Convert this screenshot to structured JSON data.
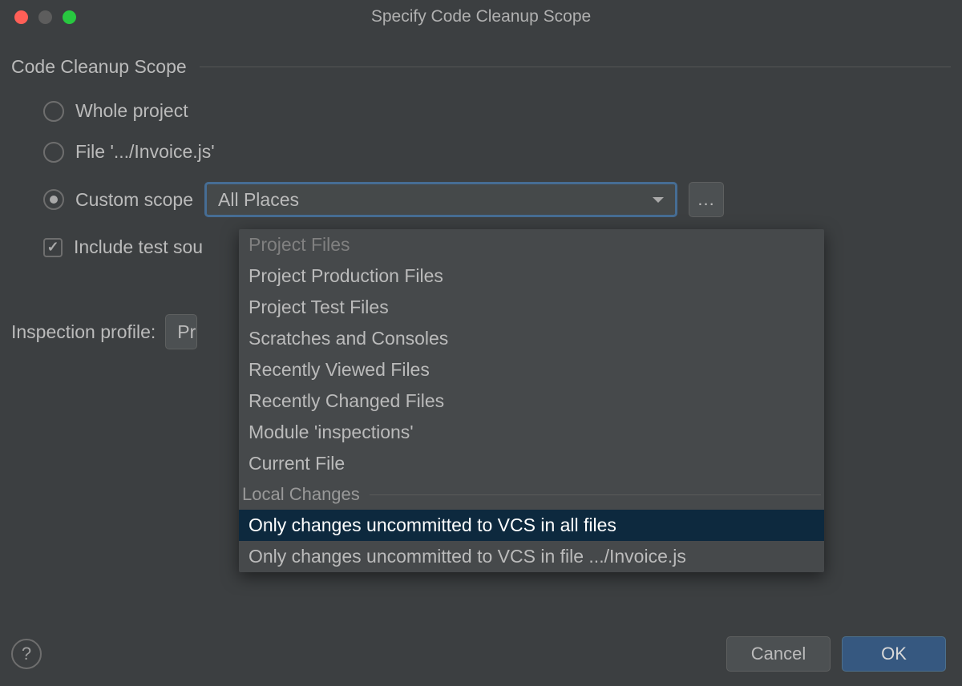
{
  "title": "Specify Code Cleanup Scope",
  "section_label": "Code Cleanup Scope",
  "radios": {
    "whole_project": "Whole project",
    "file": "File '.../Invoice.js'",
    "custom_scope": "Custom scope"
  },
  "combobox_value": "All Places",
  "ellipsis": "...",
  "include_tests": "Include test sou",
  "profile_label": "Inspection profile:",
  "profile_value": "Pr",
  "dropdown": {
    "items_top": [
      "Project Files",
      "Project Production Files",
      "Project Test Files",
      "Scratches and Consoles",
      "Recently Viewed Files",
      "Recently Changed Files",
      "Module 'inspections'",
      "Current File"
    ],
    "group_label": "Local Changes",
    "items_group": [
      "Only changes uncommitted to VCS in all files",
      "Only changes uncommitted to VCS in file .../Invoice.js"
    ],
    "highlighted_index": 0
  },
  "footer": {
    "cancel": "Cancel",
    "ok": "OK",
    "help": "?"
  }
}
